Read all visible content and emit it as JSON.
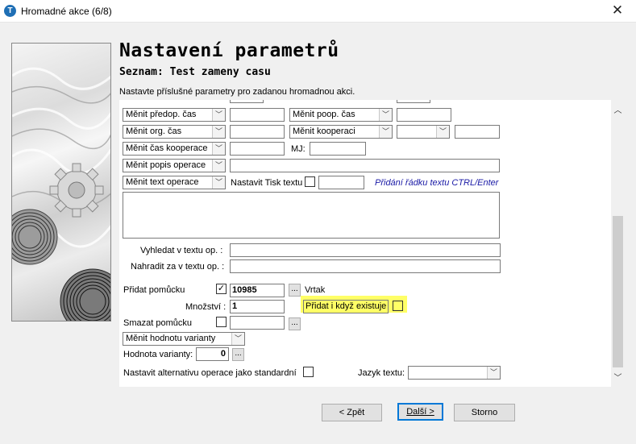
{
  "window": {
    "title": "Hromadné akce (6/8)",
    "app_icon": "T"
  },
  "header": {
    "title": "Nastavení parametrů",
    "subtitle": "Seznam: Test zameny casu",
    "description": "Nastavte příslušné parametry pro zadanou hromadnou akci."
  },
  "form": {
    "row1": {
      "left_combo": "Měnit předop. čas",
      "left_value": "",
      "right_combo": "Měnit poop. čas",
      "right_value": ""
    },
    "row2": {
      "left_combo": "Měnit org. čas",
      "left_value": "",
      "right_combo": "Měnit kooperaci",
      "right_combo2": "",
      "right_value": ""
    },
    "row3": {
      "combo": "Měnit čas kooperace",
      "value": "",
      "mj_label": "MJ:",
      "mj_value": ""
    },
    "row4": {
      "combo": "Měnit popis operace",
      "value": ""
    },
    "row5": {
      "combo": "Měnit text operace",
      "print_label": "Nastavit Tisk textu",
      "print_checked": false,
      "print_value": "",
      "hint": "Přidání řádku textu CTRL/Enter"
    },
    "text_area": "",
    "search_label": "Vyhledat v textu op.  :",
    "search_value": "",
    "replace_label": "Nahradit za v textu op.  :",
    "replace_value": "",
    "add_tool_label": "Přidat pomůcku",
    "add_tool_checked": true,
    "add_tool_code": "10985",
    "add_tool_ellipsis": "...",
    "add_tool_name": "Vrtak",
    "quantity_label": "Množství :",
    "quantity_value": "1",
    "add_if_exists_label": "Přidat i když existuje",
    "add_if_exists_checked": false,
    "delete_tool_label": "Smazat pomůcku",
    "delete_tool_checked": false,
    "delete_tool_value": "",
    "delete_tool_ellipsis": "...",
    "variant_combo": "Měnit hodnotu varianty",
    "variant_value_label": "Hodnota varianty:",
    "variant_value": "0",
    "variant_ellipsis": "...",
    "alt_label": "Nastavit alternativu operace jako standardní",
    "alt_checked": false,
    "lang_label": "Jazyk textu:",
    "lang_value": ""
  },
  "buttons": {
    "back": "< Zpět",
    "next": "Další >",
    "cancel": "Storno"
  },
  "colors": {
    "hint": "#1a1aa6",
    "highlight": "#ffff66",
    "accent": "#0078d7"
  },
  "icons": {
    "close": "close-icon",
    "dropdown": "chevron-down-icon",
    "check": "check-icon"
  }
}
